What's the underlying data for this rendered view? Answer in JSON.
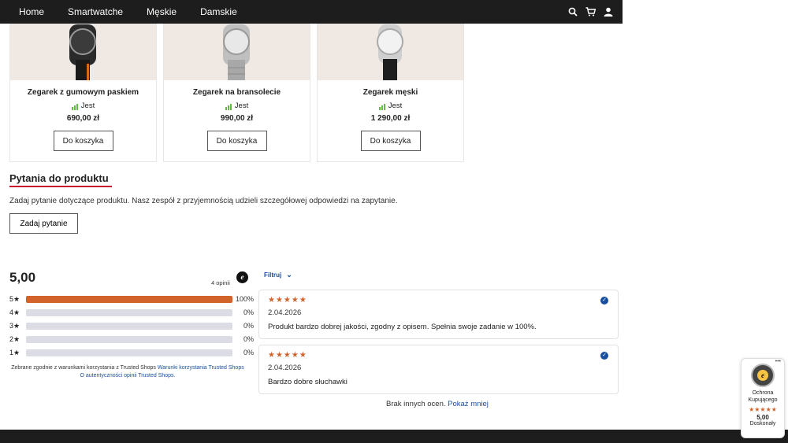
{
  "nav": {
    "items": [
      "Home",
      "Smartwatche",
      "Męskie",
      "Damskie"
    ]
  },
  "products": [
    {
      "title": "Zegarek z gumowym paskiem",
      "stock": "Jest",
      "price": "690,00 zł",
      "button": "Do koszyka"
    },
    {
      "title": "Zegarek na bransolecie",
      "stock": "Jest",
      "price": "990,00 zł",
      "button": "Do koszyka"
    },
    {
      "title": "Zegarek męski",
      "stock": "Jest",
      "price": "1 290,00 zł",
      "button": "Do koszyka"
    }
  ],
  "questions": {
    "title": "Pytania do produktu",
    "description": "Zadaj pytanie dotyczące produktu. Nasz zespół z przyjemnością udzieli szczegółowej odpowiedzi na zapytanie.",
    "button": "Zadaj pytanie"
  },
  "reviews": {
    "score": "5,00",
    "count_label": "4 opinii",
    "filter_label": "Filtruj",
    "distribution": [
      {
        "label": "5★",
        "percent": "100%",
        "fraction": 1.0
      },
      {
        "label": "4★",
        "percent": "0%",
        "fraction": 0
      },
      {
        "label": "3★",
        "percent": "0%",
        "fraction": 0
      },
      {
        "label": "2★",
        "percent": "0%",
        "fraction": 0
      },
      {
        "label": "1★",
        "percent": "0%",
        "fraction": 0
      }
    ],
    "legal_text": "Zebrane zgodnie z warunkami korzystania z Trusted Shops",
    "legal_link": "Warunki korzystania Trusted Shops",
    "authenticity_link": "O autentyczności opinii Trusted Shops.",
    "items": [
      {
        "stars": "★★★★★",
        "date": "2.04.2026",
        "text": "Produkt bardzo dobrej jakości, zgodny z opisem. Spełnia swoje zadanie w 100%."
      },
      {
        "stars": "★★★★★",
        "date": "2.04.2026",
        "text": "Bardzo dobre słuchawki"
      }
    ],
    "no_more_text": "Brak innych ocen.",
    "show_less": "Pokaż mniej"
  },
  "badge": {
    "label": "Ochrona Kupującego",
    "stars": "★★★★★",
    "score": "5,00",
    "grade": "Doskonały"
  },
  "colors": {
    "accent": "#c8102e",
    "star": "#d2632a",
    "link": "#1a4fa0",
    "stock_green": "#5fbf3a"
  }
}
